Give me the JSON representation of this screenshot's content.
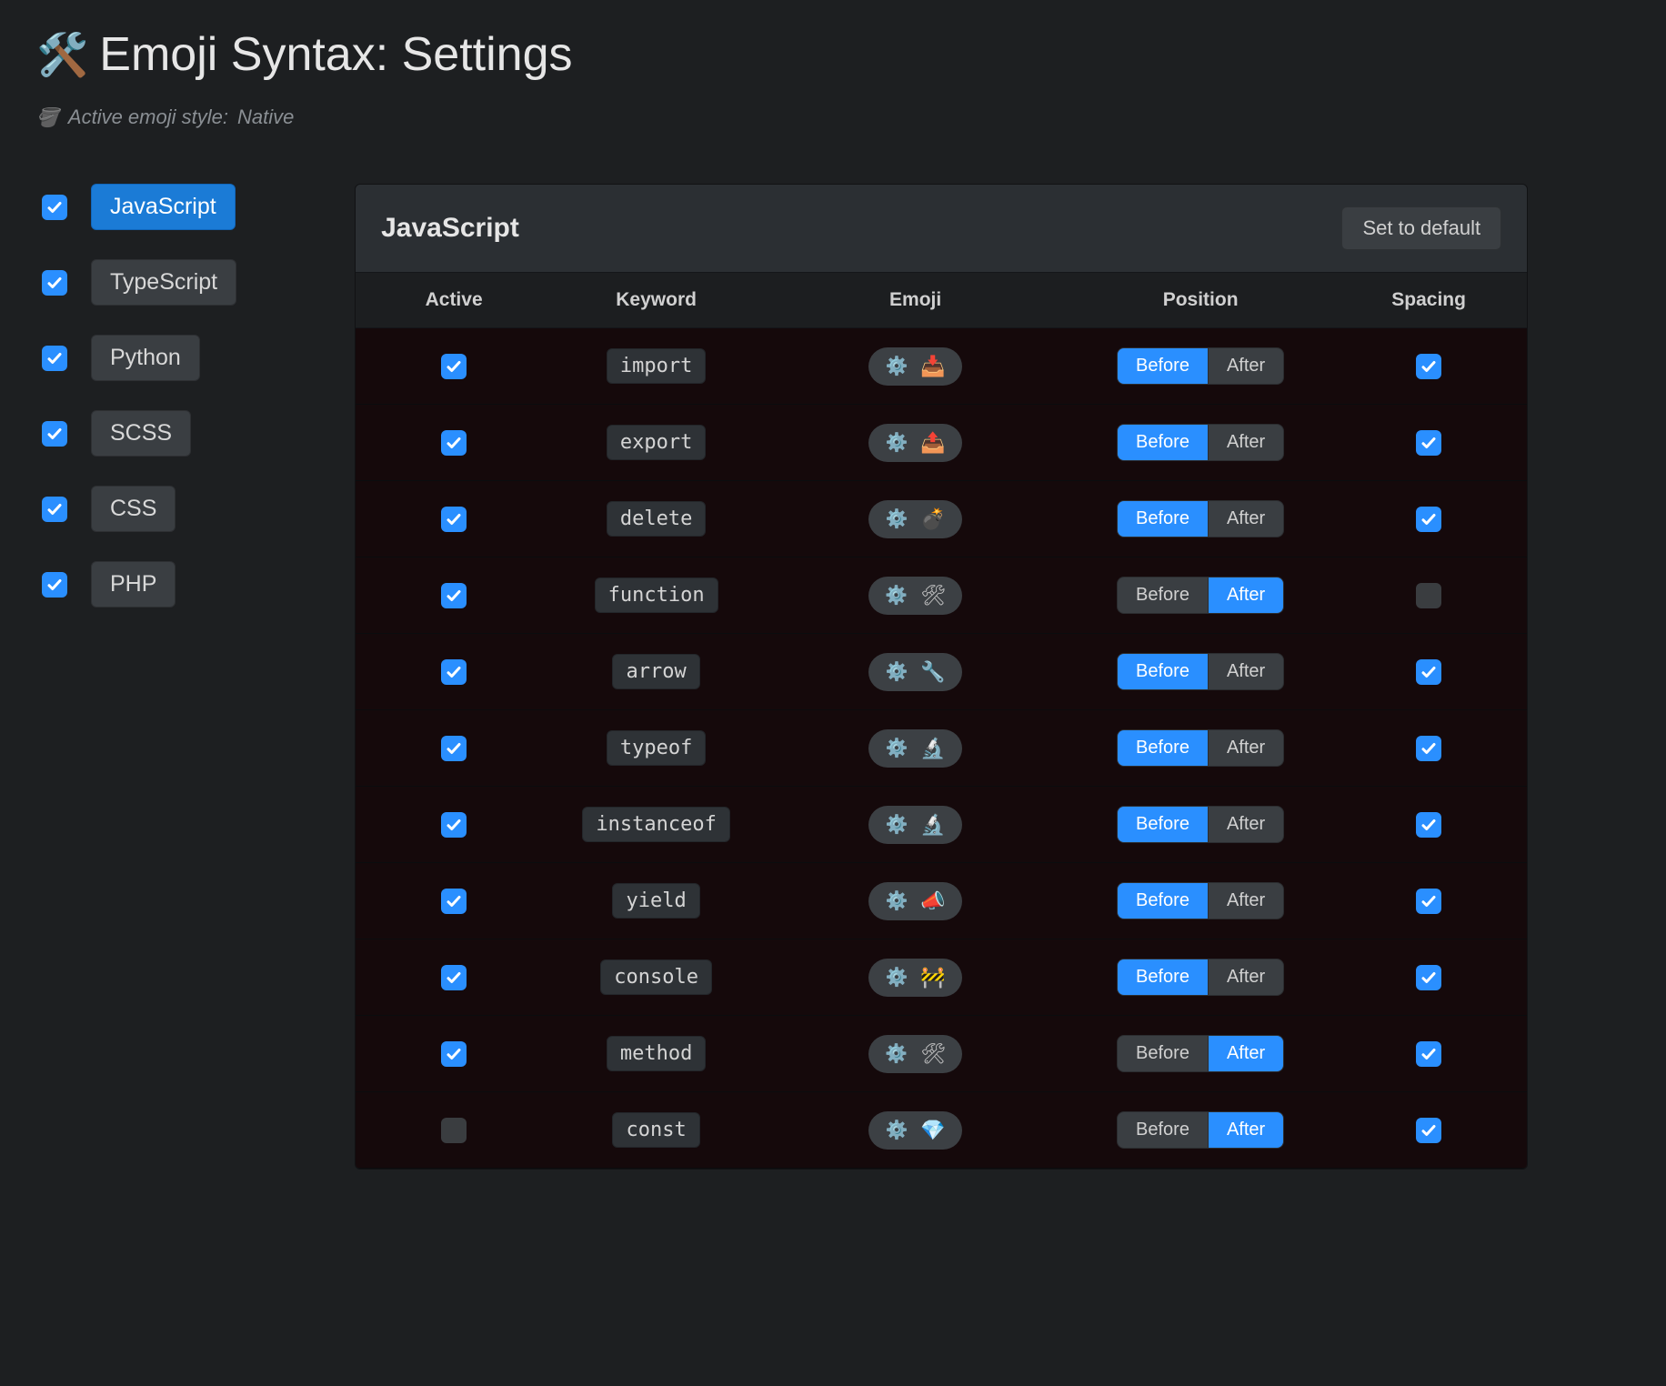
{
  "header": {
    "title": "Emoji Syntax: Settings"
  },
  "subtitle": {
    "label": "Active emoji style:",
    "style": "Native"
  },
  "sidebar": {
    "items": [
      {
        "label": "JavaScript",
        "checked": true,
        "active": true
      },
      {
        "label": "TypeScript",
        "checked": true,
        "active": false
      },
      {
        "label": "Python",
        "checked": true,
        "active": false
      },
      {
        "label": "SCSS",
        "checked": true,
        "active": false
      },
      {
        "label": "CSS",
        "checked": true,
        "active": false
      },
      {
        "label": "PHP",
        "checked": true,
        "active": false
      }
    ]
  },
  "panel": {
    "title": "JavaScript",
    "default_btn": "Set to default",
    "columns": {
      "active": "Active",
      "keyword": "Keyword",
      "emoji": "Emoji",
      "position": "Position",
      "spacing": "Spacing"
    },
    "position_labels": {
      "before": "Before",
      "after": "After"
    },
    "rows": [
      {
        "active": true,
        "keyword": "import",
        "emoji": "📥",
        "position": "before",
        "spacing": true
      },
      {
        "active": true,
        "keyword": "export",
        "emoji": "📤",
        "position": "before",
        "spacing": true
      },
      {
        "active": true,
        "keyword": "delete",
        "emoji": "💣",
        "position": "before",
        "spacing": true
      },
      {
        "active": true,
        "keyword": "function",
        "emoji": "🛠",
        "position": "after",
        "spacing": false
      },
      {
        "active": true,
        "keyword": "arrow",
        "emoji": "🔧",
        "position": "before",
        "spacing": true
      },
      {
        "active": true,
        "keyword": "typeof",
        "emoji": "🔬",
        "position": "before",
        "spacing": true
      },
      {
        "active": true,
        "keyword": "instanceof",
        "emoji": "🔬",
        "position": "before",
        "spacing": true
      },
      {
        "active": true,
        "keyword": "yield",
        "emoji": "📣",
        "position": "before",
        "spacing": true
      },
      {
        "active": true,
        "keyword": "console",
        "emoji": "🚧",
        "position": "before",
        "spacing": true
      },
      {
        "active": true,
        "keyword": "method",
        "emoji": "🛠",
        "position": "after",
        "spacing": true
      },
      {
        "active": false,
        "keyword": "const",
        "emoji": "💎",
        "position": "after",
        "spacing": true
      }
    ]
  }
}
